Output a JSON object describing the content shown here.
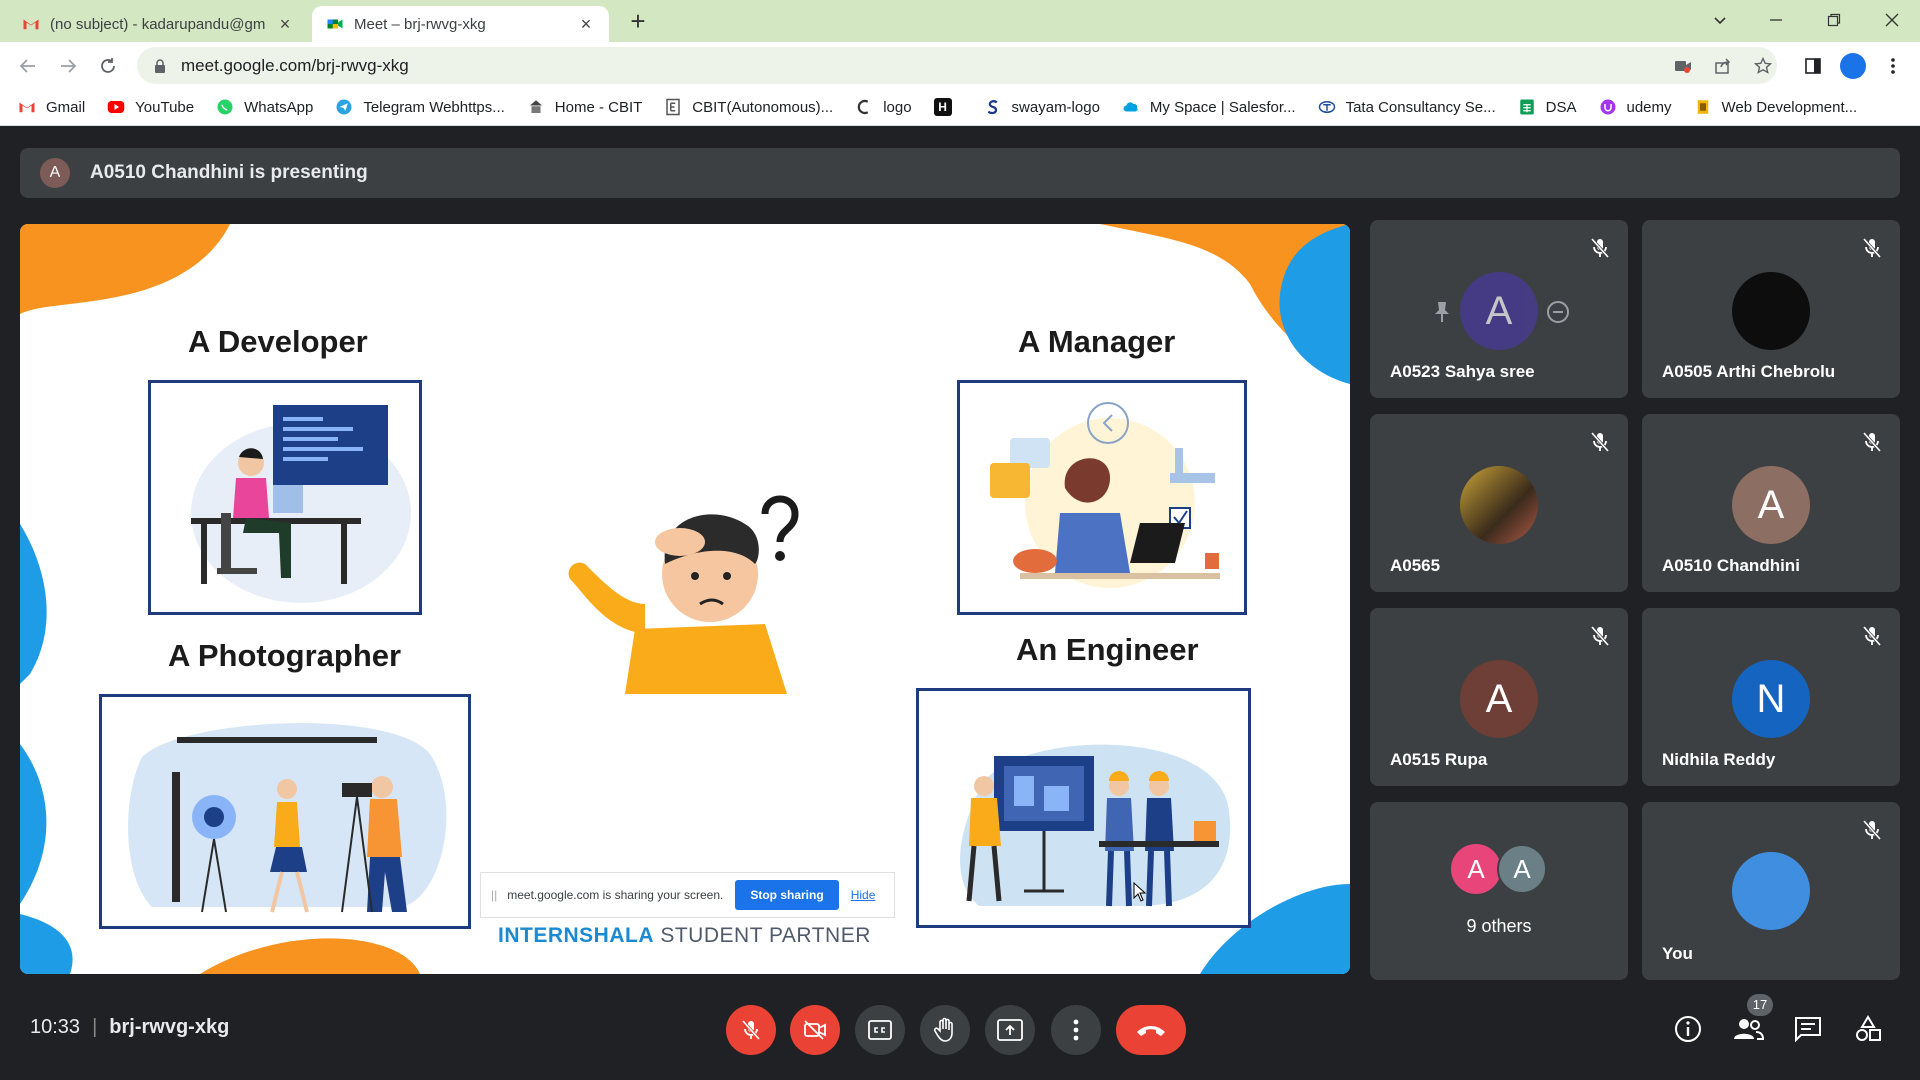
{
  "browser": {
    "tabs": [
      {
        "title": "(no subject) - kadarupandu@gm",
        "active": false
      },
      {
        "title": "Meet – brj-rwvg-xkg",
        "active": true
      }
    ],
    "url": "meet.google.com/brj-rwvg-xkg",
    "bookmarks": [
      "Gmail",
      "YouTube",
      "WhatsApp",
      "Telegram Webhttps...",
      "Home - CBIT",
      "CBIT(Autonomous)...",
      "logo",
      "swayam-logo",
      "My Space | Salesfor...",
      "Tata Consultancy Se...",
      "DSA",
      "udemy",
      "Web Development..."
    ]
  },
  "meet": {
    "presenting_text": "A0510 Chandhini is presenting",
    "presenter_initial": "A",
    "slide": {
      "headings": {
        "developer": "A Developer",
        "manager": "A Manager",
        "photographer": "A Photographer",
        "engineer": "An Engineer"
      },
      "share_bar": {
        "message": "meet.google.com is sharing your screen.",
        "stop_label": "Stop sharing",
        "hide_label": "Hide"
      },
      "footer_brand_a": "INTERN",
      "footer_brand_b": "SHALA",
      "footer_brand_c": " STUDENT PARTNER"
    },
    "participants": [
      {
        "name": "A0523 Sahya sree",
        "initial": "A",
        "color": "#4a3aa0"
      },
      {
        "name": "A0505 Arthi Chebrolu",
        "initial": "",
        "color": "#0d0d0d"
      },
      {
        "name": "A0565",
        "initial": "",
        "color": "#7a6a3a"
      },
      {
        "name": "A0510 Chandhini",
        "initial": "A",
        "color": "#8d6e63"
      },
      {
        "name": "A0515 Rupa",
        "initial": "A",
        "color": "#6d3f36"
      },
      {
        "name": "Nidhila Reddy",
        "initial": "N",
        "color": "#1565c0"
      },
      {
        "name": "9 others",
        "initial": "",
        "color": ""
      },
      {
        "name": "You",
        "initial": "",
        "color": "#3f8ee0"
      }
    ],
    "others_initials": [
      "A",
      "A"
    ],
    "time": "10:33",
    "meeting_code": "brj-rwvg-xkg",
    "people_count": "17"
  }
}
